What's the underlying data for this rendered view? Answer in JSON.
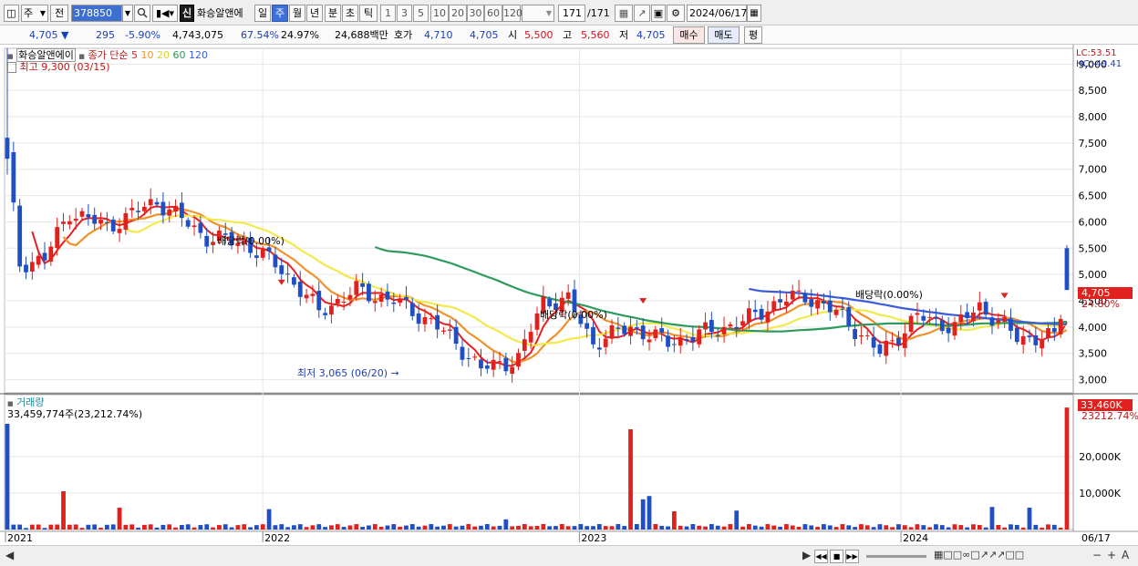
{
  "toolbar": {
    "period_select": "주",
    "prev_label": "전",
    "code": "378850",
    "search_icon": "search-icon",
    "sound_icon": "speaker-icon",
    "badge": "신",
    "stock_name": "화승알앤에",
    "period_tabs": [
      "일",
      "주",
      "월",
      "년",
      "분",
      "초",
      "틱"
    ],
    "active_period": "주",
    "interval_buttons": [
      "1",
      "3",
      "5",
      "10",
      "20",
      "30",
      "60",
      "120"
    ],
    "count": "171",
    "count_total": "/171",
    "date": "2024/06/17"
  },
  "infobar": {
    "price": "4,705",
    "change": "295",
    "change_pct": "-5.90%",
    "volume": "4,743,075",
    "vol_ratio": "67.54%",
    "turnover": "24.97%",
    "amount": "24,688백만",
    "quote_label": "호가",
    "ask": "4,710",
    "bid": "4,705",
    "open_label": "시",
    "open": "5,500",
    "high_label": "고",
    "high": "5,560",
    "low_label": "저",
    "low": "4,705",
    "buy_button": "매수",
    "sell_button": "매도",
    "flat_button": "평"
  },
  "price_panel": {
    "title": "화승알앤에이",
    "ma_label": "종가 단순",
    "ma_periods": [
      "5",
      "10",
      "20",
      "60",
      "120"
    ],
    "ma_colors": [
      "#e8201f",
      "#f0922b",
      "#f2e94b",
      "#2e9a5d",
      "#3b5bdb"
    ],
    "high_note": "최고 9,300 (03/15)",
    "low_note": "최저 3,065 (06/20)",
    "lc_label": "LC:53.51",
    "hc_label": "HC:-49.41",
    "current_tag": "4,705",
    "current_pct": "24.80%",
    "dividend_labels": [
      "배당락(0.00%)",
      "배당락(0.00%)",
      "배당락(0.00%)"
    ]
  },
  "volume_panel": {
    "title": "거래량",
    "value": "33,459,774주(23,212.74%)",
    "current_tag": "33,460K",
    "current_pct": "23212.74%"
  },
  "date_axis": {
    "end_label": "06/17"
  },
  "colors": {
    "up": "#e0211d",
    "down": "#1f4fc3",
    "grid": "#e6e6e6"
  },
  "chart_data": {
    "type": "candlestick",
    "x_labels": [
      "2021",
      "2022",
      "2023",
      "2024"
    ],
    "price_axis": {
      "ticks": [
        3000,
        3500,
        4000,
        4500,
        5000,
        5500,
        6000,
        6500,
        7000,
        7500,
        8000,
        8500,
        9000
      ],
      "tick_labels": [
        "3,000",
        "3,500",
        "4,000",
        "4,500",
        "5,000",
        "5,500",
        "6,000",
        "6,500",
        "7,000",
        "7,500",
        "8,000",
        "8,500",
        "9,000"
      ],
      "ylim": [
        2750,
        9300
      ]
    },
    "volume_axis": {
      "ticks": [
        10000,
        20000
      ],
      "tick_labels": [
        "10,000K",
        "20,000K"
      ],
      "ylim": [
        0,
        35000
      ]
    },
    "weekly_close_anchors": [
      {
        "week": 0,
        "close": 7200
      },
      {
        "week": 2,
        "close": 5200
      },
      {
        "week": 6,
        "close": 5300
      },
      {
        "week": 10,
        "close": 6200
      },
      {
        "week": 16,
        "close": 5900
      },
      {
        "week": 24,
        "close": 6400
      },
      {
        "week": 32,
        "close": 5700
      },
      {
        "week": 38,
        "close": 5600
      },
      {
        "week": 44,
        "close": 5100
      },
      {
        "week": 50,
        "close": 4300
      },
      {
        "week": 56,
        "close": 4700
      },
      {
        "week": 62,
        "close": 4500
      },
      {
        "week": 68,
        "close": 4100
      },
      {
        "week": 72,
        "close": 3700
      },
      {
        "week": 76,
        "close": 3200
      },
      {
        "week": 82,
        "close": 3400
      },
      {
        "week": 86,
        "close": 4500
      },
      {
        "week": 90,
        "close": 4500
      },
      {
        "week": 94,
        "close": 3700
      },
      {
        "week": 100,
        "close": 4000
      },
      {
        "week": 106,
        "close": 3700
      },
      {
        "week": 112,
        "close": 3900
      },
      {
        "week": 118,
        "close": 4100
      },
      {
        "week": 124,
        "close": 4500
      },
      {
        "week": 128,
        "close": 4600
      },
      {
        "week": 134,
        "close": 4200
      },
      {
        "week": 140,
        "close": 3500
      },
      {
        "week": 146,
        "close": 4200
      },
      {
        "week": 152,
        "close": 4000
      },
      {
        "week": 156,
        "close": 4400
      },
      {
        "week": 162,
        "close": 3800
      },
      {
        "week": 168,
        "close": 3800
      },
      {
        "week": 170,
        "close": 4705
      }
    ],
    "last_candle": {
      "open": 5500,
      "high": 5560,
      "low": 4705,
      "close": 4705
    },
    "ma_values_last": {
      "ma5": 3900,
      "ma10": 3850,
      "ma20": 3800,
      "ma60": 4000,
      "ma120": 4050
    },
    "volume_spikes": [
      {
        "week": 0,
        "volume": 29000
      },
      {
        "week": 9,
        "volume": 10500
      },
      {
        "week": 18,
        "volume": 6000
      },
      {
        "week": 42,
        "volume": 5600
      },
      {
        "week": 80,
        "volume": 2800
      },
      {
        "week": 100,
        "volume": 27500
      },
      {
        "week": 102,
        "volume": 8300
      },
      {
        "week": 103,
        "volume": 9200
      },
      {
        "week": 107,
        "volume": 5000
      },
      {
        "week": 117,
        "volume": 5200
      },
      {
        "week": 158,
        "volume": 6200
      },
      {
        "week": 164,
        "volume": 6000
      },
      {
        "week": 170,
        "volume": 33460
      }
    ]
  }
}
